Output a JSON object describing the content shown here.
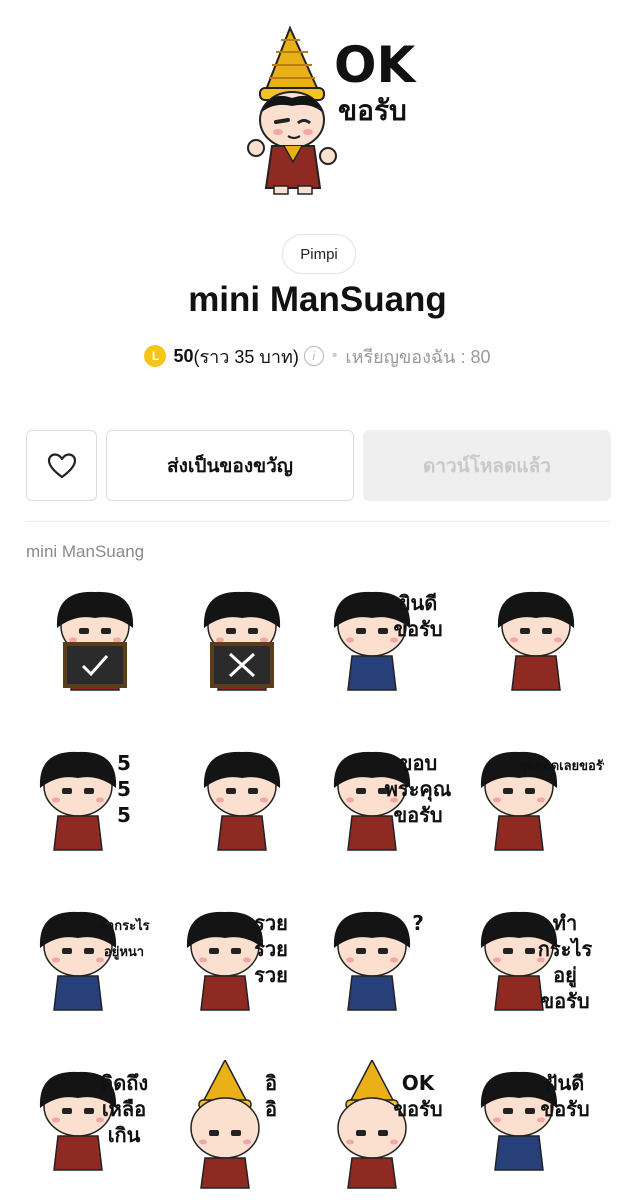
{
  "hero": {
    "sticker_caption_en": "OK",
    "sticker_caption_th": "ขอรับ"
  },
  "author": "Pimpi",
  "title": "mini ManSuang",
  "price": {
    "coin_letter": "L",
    "amount": "50",
    "approx": "(ราว 35 บาท)",
    "info_glyph": "i",
    "separator": "•",
    "balance": "เหรียญของฉัน : 80"
  },
  "buttons": {
    "like_icon": "heart-icon",
    "gift_label": "ส่งเป็นของขวัญ",
    "download_label": "ดาวน์โหลดแล้ว"
  },
  "section_label": "mini ManSuang",
  "stickers": [
    {
      "caption": ""
    },
    {
      "caption": ""
    },
    {
      "caption": "ยินดี ขอรับ"
    },
    {
      "caption": ""
    },
    {
      "caption": "5 5 5"
    },
    {
      "caption": ""
    },
    {
      "caption": "ขอบ พระคุณ ขอรับ"
    },
    {
      "caption": "สุดยอดเลยขอรับ"
    },
    {
      "caption": "ทำกระไร อยู่หนา"
    },
    {
      "caption": "รวย รวย รวย"
    },
    {
      "caption": "?"
    },
    {
      "caption": "ทำ กระไร อยู่ ขอรับ"
    },
    {
      "caption": "คิดถึง เหลือ เกิน"
    },
    {
      "caption": "อิ อิ"
    },
    {
      "caption": "OK ขอรับ"
    },
    {
      "caption": "ฝันดี ขอรับ"
    }
  ],
  "colors": {
    "coin": "#f5c518",
    "download_disabled_bg": "#efefef",
    "download_disabled_text": "#c9c9c9",
    "hair": "#141414",
    "skin": "#fbe0cf",
    "gold_crown": "#e9b017",
    "costume_red": "#8e2a22"
  }
}
